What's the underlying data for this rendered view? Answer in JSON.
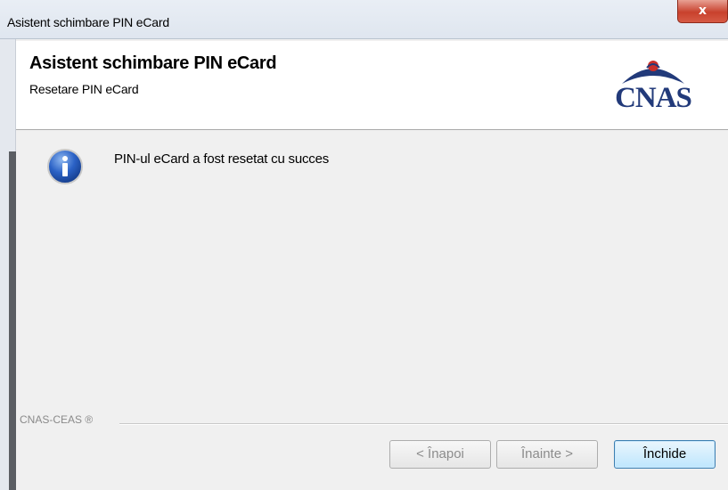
{
  "window": {
    "title": "Asistent schimbare PIN eCard",
    "close_glyph": "x"
  },
  "header": {
    "title": "Asistent schimbare PIN eCard",
    "subtitle": "Resetare PIN eCard",
    "logo_text": "CNAS",
    "logo_color": "#223a7a",
    "logo_accent": "#c8302a"
  },
  "content": {
    "icon": "info-icon",
    "message": "PIN-ul eCard a fost resetat cu succes"
  },
  "footer": {
    "brand": "CNAS-CEAS ®",
    "buttons": {
      "back": "< Înapoi",
      "next": "Înainte >",
      "close": "Închide"
    }
  }
}
